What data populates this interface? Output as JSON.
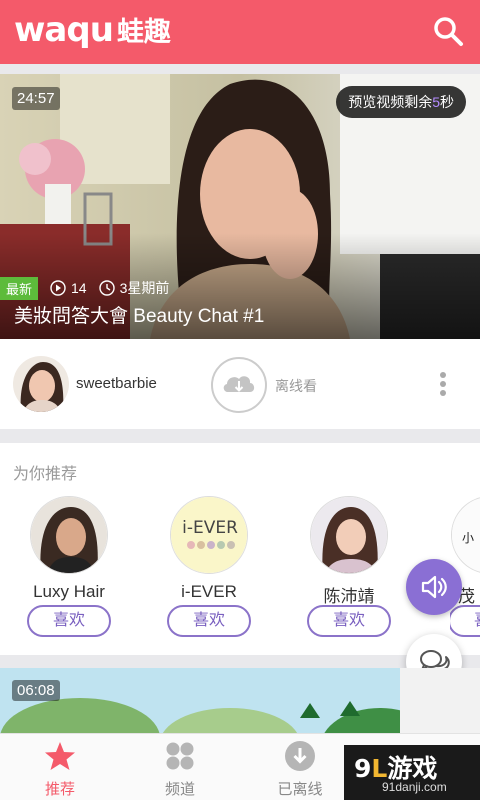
{
  "app": {
    "logo_en": "waqu",
    "logo_cn": "蛙趣",
    "header_color": "#f45a6a",
    "search_icon": "search-icon"
  },
  "video_card": {
    "duration": "24:57",
    "preview_prefix": "预览视频剩余",
    "preview_seconds": "5",
    "preview_suffix": "秒",
    "badge": "最新",
    "plays": "14",
    "time_ago": "3星期前",
    "title": "美妝問答大會 Beauty Chat #1",
    "uploader": "sweetbarbie",
    "offline_label": "离线看",
    "icons": [
      "play-count-icon",
      "clock-icon",
      "cloud-download-icon",
      "more-vertical-icon"
    ]
  },
  "recommend": {
    "title": "为你推荐",
    "like_label": "喜欢",
    "items": [
      {
        "name": "Luxy Hair"
      },
      {
        "name": "i-EVER"
      },
      {
        "name": "陈沛靖"
      },
      {
        "name": "茂"
      }
    ]
  },
  "video_card_2": {
    "duration": "06:08"
  },
  "floating": {
    "sound_icon": "speaker-icon",
    "chat_icon": "chat-bubble-icon"
  },
  "bottom_nav": {
    "items": [
      {
        "label": "推荐",
        "icon": "star-icon",
        "active": true
      },
      {
        "label": "频道",
        "icon": "grid-icon",
        "active": false
      },
      {
        "label": "已离线",
        "icon": "download-icon",
        "active": false
      }
    ],
    "active_color": "#f45a6a"
  },
  "watermark": {
    "main_prefix": "9",
    "main_mid": "L",
    "main_suffix": "游戏",
    "sub": "91danji.com"
  }
}
